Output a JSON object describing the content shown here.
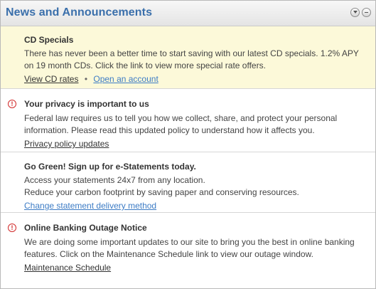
{
  "panel": {
    "title": "News and Announcements",
    "accent_color": "#3a6fab",
    "highlight_bg": "#fcf9d9",
    "alert_color": "#d12a2a"
  },
  "items": [
    {
      "title": "CD Specials",
      "body": "There has never been a better time to start saving with our latest CD specials. 1.2% APY on 19 month CDs. Click the link to view more special rate offers.",
      "links": [
        "View CD rates",
        "Open an account"
      ],
      "separator": "•",
      "icon": null
    },
    {
      "title": "Your privacy is important to us",
      "body": "Federal law requires us to tell you how we collect, share, and protect your personal information. Please read this updated policy to understand how it affects you.",
      "links": [
        "Privacy policy updates"
      ],
      "icon": "alert-icon",
      "icon_glyph": "!"
    },
    {
      "title": "Go Green! Sign up for e-Statements today.",
      "body_lines": [
        "Access your statements 24x7 from any location.",
        "Reduce your carbon footprint by saving paper and conserving resources."
      ],
      "links": [
        "Change statement delivery method"
      ],
      "icon": null
    },
    {
      "title": "Online Banking Outage Notice",
      "body": "We are doing some important updates to our site to bring you the best in online banking features. Click on the Maintenance Schedule link to view our outage window.",
      "links": [
        "Maintenance Schedule"
      ],
      "icon": "alert-icon",
      "icon_glyph": "!"
    }
  ]
}
